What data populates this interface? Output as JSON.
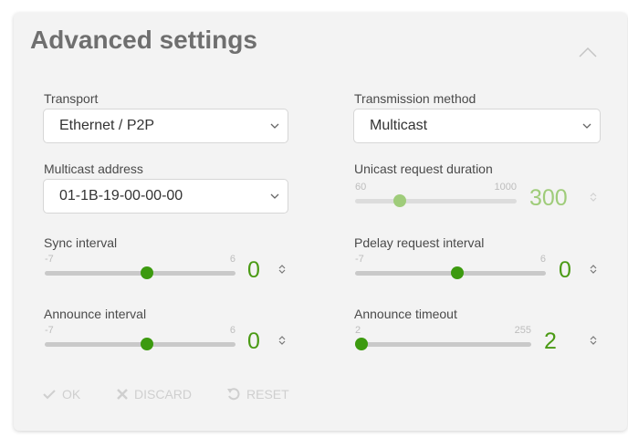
{
  "title": "Advanced settings",
  "transport": {
    "label": "Transport",
    "value": "Ethernet / P2P"
  },
  "transmission": {
    "label": "Transmission method",
    "value": "Multicast"
  },
  "multicast": {
    "label": "Multicast address",
    "value": "01-1B-19-00-00-00"
  },
  "unicast": {
    "label": "Unicast request duration",
    "min": "60",
    "max": "1000",
    "value": "300",
    "fraction": 0.255
  },
  "sync": {
    "label": "Sync interval",
    "min": "-7",
    "max": "6",
    "value": "0",
    "fraction": 0.54
  },
  "pdelay": {
    "label": "Pdelay request interval",
    "min": "-7",
    "max": "6",
    "value": "0",
    "fraction": 0.54
  },
  "announce_interval": {
    "label": "Announce interval",
    "min": "-7",
    "max": "6",
    "value": "0",
    "fraction": 0.54
  },
  "announce_timeout": {
    "label": "Announce timeout",
    "min": "2",
    "max": "255",
    "value": "2",
    "fraction": 0.0
  },
  "actions": {
    "ok": "OK",
    "discard": "DISCARD",
    "reset": "RESET"
  },
  "colors": {
    "accent": "#4a9a14",
    "accent_light": "#9fcc7a",
    "track": "#c9c9c9",
    "panel": "#f3f3f3"
  },
  "icons": {
    "collapse": "chevron-up-icon",
    "select": "chevron-down-icon",
    "spin": "spinner-arrows-icon",
    "ok": "check-icon",
    "discard": "x-icon",
    "reset": "undo-icon"
  }
}
